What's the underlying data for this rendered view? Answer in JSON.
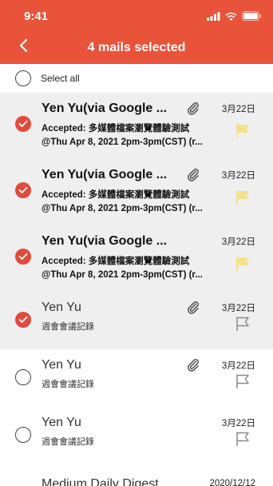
{
  "status_bar": {
    "time": "9:41"
  },
  "header": {
    "title": "4 mails selected"
  },
  "select_all": {
    "label": "Select all"
  },
  "mails": [
    {
      "sender": "Yen Yu(via Google ...",
      "subject": "Accepted: 多媒體檔案瀏覽體驗測試",
      "preview": "@Thu Apr 8, 2021 2pm-3pm(CST) (r...",
      "date": "3月22日",
      "selected": true,
      "unread": true,
      "attachment": true,
      "flag_color": "#f5e08c"
    },
    {
      "sender": "Yen Yu(via Google ...",
      "subject": "Accepted: 多媒體檔案瀏覽體驗測試",
      "preview": "@Thu Apr 8, 2021 2pm-3pm(CST) (r...",
      "date": "3月22日",
      "selected": true,
      "unread": true,
      "attachment": true,
      "flag_color": "#f5e08c"
    },
    {
      "sender": "Yen Yu(via Google ...",
      "subject": "Accepted: 多媒體檔案瀏覽體驗測試",
      "preview": "@Thu Apr 8, 2021 2pm-3pm(CST) (r...",
      "date": "3月22日",
      "selected": true,
      "unread": true,
      "attachment": false,
      "flag_color": "#f5e08c"
    },
    {
      "sender": "Yen Yu",
      "subject": "週會會議記錄",
      "date": "3月22日",
      "selected": true,
      "unread": false,
      "attachment": true,
      "flag_color": "none"
    },
    {
      "sender": "Yen Yu",
      "subject": "週會會議記錄",
      "date": "3月22日",
      "selected": false,
      "unread": false,
      "attachment": true,
      "flag_color": "none"
    },
    {
      "sender": "Yen Yu",
      "subject": "週會會議記錄",
      "date": "3月22日",
      "selected": false,
      "unread": false,
      "attachment": false,
      "flag_color": "none"
    },
    {
      "sender": "Medium Daily Digest",
      "date": "2020/12/12",
      "selected": false,
      "unread": false,
      "attachment": false
    }
  ],
  "colors": {
    "brand": "#e8533a",
    "check": "#e14b3b",
    "selected_bg": "#efefef",
    "flag_active": "#f5e08c"
  }
}
